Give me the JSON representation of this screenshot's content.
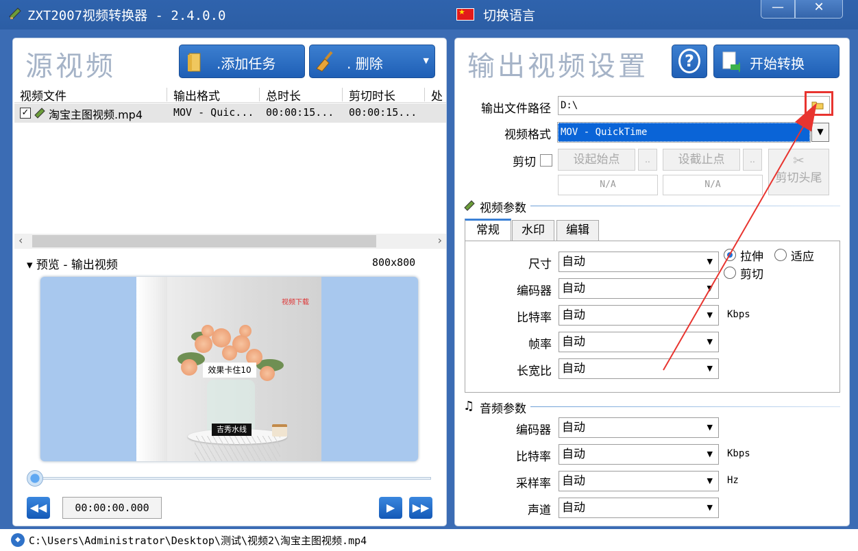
{
  "window": {
    "title": "ZXT2007视频转换器 - 2.4.0.0",
    "language_label": "切换语言",
    "minimize": "—",
    "close": "✕"
  },
  "left": {
    "title": "源视频",
    "add_task": ".添加任务",
    "delete": ".  删除",
    "columns": [
      "视频文件",
      "输出格式",
      "总时长",
      "剪切时长",
      "处"
    ],
    "rows": [
      {
        "file": "淘宝主图视频.mp4",
        "format": "MOV - Quic...",
        "total": "00:00:15...",
        "cut": "00:00:15...",
        "checked": true
      }
    ],
    "preview_label": "▾ 预览 - 输出视频",
    "resolution": "800x800",
    "watermark_text": "效果卡住10",
    "watermark_bottom": "吉秀水线",
    "watermark_red": "视频下载",
    "progress": 0,
    "time": "00:00:00.000"
  },
  "right": {
    "title": "输出视频设置",
    "start": "开始转换",
    "help_icon": "?",
    "output_path_label": "输出文件路径",
    "output_path": "D:\\",
    "format_label": "视频格式",
    "format": "MOV - QuickTime",
    "cut_label": "剪切",
    "set_start": "设起始点",
    "set_end": "设截止点",
    "dots": "..",
    "start_value": "N/A",
    "end_value": "N/A",
    "cut_head_tail": "剪切头尾",
    "video_params": "视频参数",
    "tabs": [
      "常规",
      "水印",
      "编辑"
    ],
    "video_fields": [
      {
        "label": "尺寸",
        "value": "自动",
        "unit": ""
      },
      {
        "label": "编码器",
        "value": "自动",
        "unit": ""
      },
      {
        "label": "比特率",
        "value": "自动",
        "unit": "Kbps"
      },
      {
        "label": "帧率",
        "value": "自动",
        "unit": ""
      },
      {
        "label": "长宽比",
        "value": "自动",
        "unit": ""
      }
    ],
    "stretch": "拉伸",
    "fit": "适应",
    "crop": "剪切",
    "audio_params": "音频参数",
    "audio_fields": [
      {
        "label": "编码器",
        "value": "自动",
        "unit": ""
      },
      {
        "label": "比特率",
        "value": "自动",
        "unit": "Kbps"
      },
      {
        "label": "采样率",
        "value": "自动",
        "unit": "Hz"
      },
      {
        "label": "声道",
        "value": "自动",
        "unit": ""
      }
    ]
  },
  "status": {
    "path": "C:\\Users\\Administrator\\Desktop\\测试\\视频2\\淘宝主图视频.mp4"
  },
  "colors": {
    "accent": "#2c5ea5",
    "annotation": "#e8342f",
    "selection": "#0a64d7"
  }
}
